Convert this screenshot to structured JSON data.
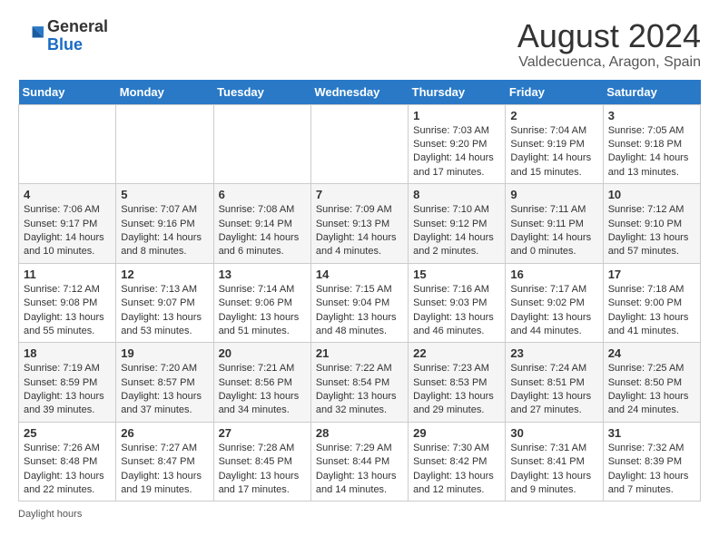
{
  "header": {
    "logo_general": "General",
    "logo_blue": "Blue",
    "month_year": "August 2024",
    "location": "Valdecuenca, Aragon, Spain"
  },
  "weekdays": [
    "Sunday",
    "Monday",
    "Tuesday",
    "Wednesday",
    "Thursday",
    "Friday",
    "Saturday"
  ],
  "weeks": [
    [
      {
        "day": "",
        "info": ""
      },
      {
        "day": "",
        "info": ""
      },
      {
        "day": "",
        "info": ""
      },
      {
        "day": "",
        "info": ""
      },
      {
        "day": "1",
        "info": "Sunrise: 7:03 AM\nSunset: 9:20 PM\nDaylight: 14 hours and 17 minutes."
      },
      {
        "day": "2",
        "info": "Sunrise: 7:04 AM\nSunset: 9:19 PM\nDaylight: 14 hours and 15 minutes."
      },
      {
        "day": "3",
        "info": "Sunrise: 7:05 AM\nSunset: 9:18 PM\nDaylight: 14 hours and 13 minutes."
      }
    ],
    [
      {
        "day": "4",
        "info": "Sunrise: 7:06 AM\nSunset: 9:17 PM\nDaylight: 14 hours and 10 minutes."
      },
      {
        "day": "5",
        "info": "Sunrise: 7:07 AM\nSunset: 9:16 PM\nDaylight: 14 hours and 8 minutes."
      },
      {
        "day": "6",
        "info": "Sunrise: 7:08 AM\nSunset: 9:14 PM\nDaylight: 14 hours and 6 minutes."
      },
      {
        "day": "7",
        "info": "Sunrise: 7:09 AM\nSunset: 9:13 PM\nDaylight: 14 hours and 4 minutes."
      },
      {
        "day": "8",
        "info": "Sunrise: 7:10 AM\nSunset: 9:12 PM\nDaylight: 14 hours and 2 minutes."
      },
      {
        "day": "9",
        "info": "Sunrise: 7:11 AM\nSunset: 9:11 PM\nDaylight: 14 hours and 0 minutes."
      },
      {
        "day": "10",
        "info": "Sunrise: 7:12 AM\nSunset: 9:10 PM\nDaylight: 13 hours and 57 minutes."
      }
    ],
    [
      {
        "day": "11",
        "info": "Sunrise: 7:12 AM\nSunset: 9:08 PM\nDaylight: 13 hours and 55 minutes."
      },
      {
        "day": "12",
        "info": "Sunrise: 7:13 AM\nSunset: 9:07 PM\nDaylight: 13 hours and 53 minutes."
      },
      {
        "day": "13",
        "info": "Sunrise: 7:14 AM\nSunset: 9:06 PM\nDaylight: 13 hours and 51 minutes."
      },
      {
        "day": "14",
        "info": "Sunrise: 7:15 AM\nSunset: 9:04 PM\nDaylight: 13 hours and 48 minutes."
      },
      {
        "day": "15",
        "info": "Sunrise: 7:16 AM\nSunset: 9:03 PM\nDaylight: 13 hours and 46 minutes."
      },
      {
        "day": "16",
        "info": "Sunrise: 7:17 AM\nSunset: 9:02 PM\nDaylight: 13 hours and 44 minutes."
      },
      {
        "day": "17",
        "info": "Sunrise: 7:18 AM\nSunset: 9:00 PM\nDaylight: 13 hours and 41 minutes."
      }
    ],
    [
      {
        "day": "18",
        "info": "Sunrise: 7:19 AM\nSunset: 8:59 PM\nDaylight: 13 hours and 39 minutes."
      },
      {
        "day": "19",
        "info": "Sunrise: 7:20 AM\nSunset: 8:57 PM\nDaylight: 13 hours and 37 minutes."
      },
      {
        "day": "20",
        "info": "Sunrise: 7:21 AM\nSunset: 8:56 PM\nDaylight: 13 hours and 34 minutes."
      },
      {
        "day": "21",
        "info": "Sunrise: 7:22 AM\nSunset: 8:54 PM\nDaylight: 13 hours and 32 minutes."
      },
      {
        "day": "22",
        "info": "Sunrise: 7:23 AM\nSunset: 8:53 PM\nDaylight: 13 hours and 29 minutes."
      },
      {
        "day": "23",
        "info": "Sunrise: 7:24 AM\nSunset: 8:51 PM\nDaylight: 13 hours and 27 minutes."
      },
      {
        "day": "24",
        "info": "Sunrise: 7:25 AM\nSunset: 8:50 PM\nDaylight: 13 hours and 24 minutes."
      }
    ],
    [
      {
        "day": "25",
        "info": "Sunrise: 7:26 AM\nSunset: 8:48 PM\nDaylight: 13 hours and 22 minutes."
      },
      {
        "day": "26",
        "info": "Sunrise: 7:27 AM\nSunset: 8:47 PM\nDaylight: 13 hours and 19 minutes."
      },
      {
        "day": "27",
        "info": "Sunrise: 7:28 AM\nSunset: 8:45 PM\nDaylight: 13 hours and 17 minutes."
      },
      {
        "day": "28",
        "info": "Sunrise: 7:29 AM\nSunset: 8:44 PM\nDaylight: 13 hours and 14 minutes."
      },
      {
        "day": "29",
        "info": "Sunrise: 7:30 AM\nSunset: 8:42 PM\nDaylight: 13 hours and 12 minutes."
      },
      {
        "day": "30",
        "info": "Sunrise: 7:31 AM\nSunset: 8:41 PM\nDaylight: 13 hours and 9 minutes."
      },
      {
        "day": "31",
        "info": "Sunrise: 7:32 AM\nSunset: 8:39 PM\nDaylight: 13 hours and 7 minutes."
      }
    ]
  ],
  "footer": {
    "daylight_label": "Daylight hours"
  }
}
